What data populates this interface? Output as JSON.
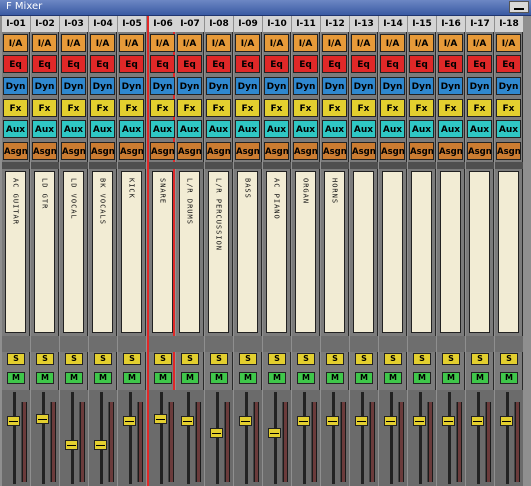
{
  "window": {
    "title": "F Mixer"
  },
  "icons": {
    "minimize": "minimize-icon"
  },
  "colors": {
    "ia": "#e79a39",
    "eq": "#e02828",
    "dyn": "#2f88cf",
    "fx": "#e3cf2f",
    "aux": "#2fc7c4",
    "asgn": "#cb7c31",
    "solo": "#e3cf2f",
    "mute": "#3fc74a"
  },
  "button_labels": {
    "ia": "I/A",
    "eq": "Eq",
    "dyn": "Dyn",
    "fx": "Fx",
    "aux": "Aux",
    "asgn": "Asgn",
    "solo": "S",
    "mute": "M"
  },
  "selected_channel": "I-06",
  "channels": [
    {
      "id": "I-01",
      "name": "AC GUITAR",
      "fader": 0.75
    },
    {
      "id": "I-02",
      "name": "LD GTR",
      "fader": 0.78
    },
    {
      "id": "I-03",
      "name": "LD VOCAL",
      "fader": 0.45
    },
    {
      "id": "I-04",
      "name": "BK VOCALS",
      "fader": 0.45
    },
    {
      "id": "I-05",
      "name": "KICK",
      "fader": 0.75
    },
    {
      "id": "I-06",
      "name": "SNARE",
      "fader": 0.78
    },
    {
      "id": "I-07",
      "name": "L/R DRUMS",
      "fader": 0.75
    },
    {
      "id": "I-08",
      "name": "L/R PERCUSSION",
      "fader": 0.6
    },
    {
      "id": "I-09",
      "name": "BASS",
      "fader": 0.75
    },
    {
      "id": "I-10",
      "name": "AC PIANO",
      "fader": 0.6
    },
    {
      "id": "I-11",
      "name": "ORGAN",
      "fader": 0.75
    },
    {
      "id": "I-12",
      "name": "HORNS",
      "fader": 0.75
    },
    {
      "id": "I-13",
      "name": "",
      "fader": 0.75
    },
    {
      "id": "I-14",
      "name": "",
      "fader": 0.75
    },
    {
      "id": "I-15",
      "name": "",
      "fader": 0.75
    },
    {
      "id": "I-16",
      "name": "",
      "fader": 0.75
    },
    {
      "id": "I-17",
      "name": "",
      "fader": 0.75
    },
    {
      "id": "I-18",
      "name": "",
      "fader": 0.75
    }
  ]
}
